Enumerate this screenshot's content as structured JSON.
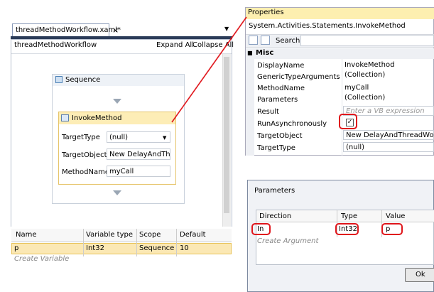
{
  "designer": {
    "tab_title": "threadMethodWorkflow.xaml*",
    "close_glyph": "×",
    "dropdown_glyph": "▼",
    "workflow_name": "threadMethodWorkflow",
    "expand_all": "Expand All",
    "collapse_all": "Collapse All",
    "sequence_label": "Sequence",
    "invoke": {
      "title": "InvokeMethod",
      "target_type_label": "TargetType",
      "target_type_value": "(null)",
      "target_object_label": "TargetObject",
      "target_object_value": "New DelayAndThre",
      "method_name_label": "MethodName",
      "method_name_value": "myCall"
    },
    "variables": {
      "headers": [
        "Name",
        "Variable type",
        "Scope",
        "Default"
      ],
      "rows": [
        [
          "p",
          "Int32",
          "Sequence",
          "10"
        ]
      ],
      "create_hint": "Create Variable"
    }
  },
  "properties": {
    "title": "Properties",
    "type_name": "System.Activities.Statements.InvokeMethod",
    "search_label": "Search:",
    "category": "Misc",
    "collapse_glyph": "■",
    "rows": [
      {
        "name": "DisplayName",
        "value": "InvokeMethod"
      },
      {
        "name": "GenericTypeArguments",
        "value": "(Collection)"
      },
      {
        "name": "MethodName",
        "value": "myCall"
      },
      {
        "name": "Parameters",
        "value": "(Collection)"
      },
      {
        "name": "Result",
        "value": "Enter a VB expression"
      },
      {
        "name": "RunAsynchronously",
        "value": "✓"
      },
      {
        "name": "TargetObject",
        "value": "New DelayAndThreadWorkfl"
      },
      {
        "name": "TargetType",
        "value": "(null)"
      }
    ]
  },
  "parameters_dialog": {
    "title": "Parameters",
    "headers": [
      "Direction",
      "Type",
      "Value"
    ],
    "row": [
      "In",
      "Int32",
      "p"
    ],
    "create_hint": "Create Argument",
    "ok_label": "Ok"
  },
  "colors": {
    "annotation_red": "#e0151b",
    "selection_yellow": "#fbe8b4"
  }
}
